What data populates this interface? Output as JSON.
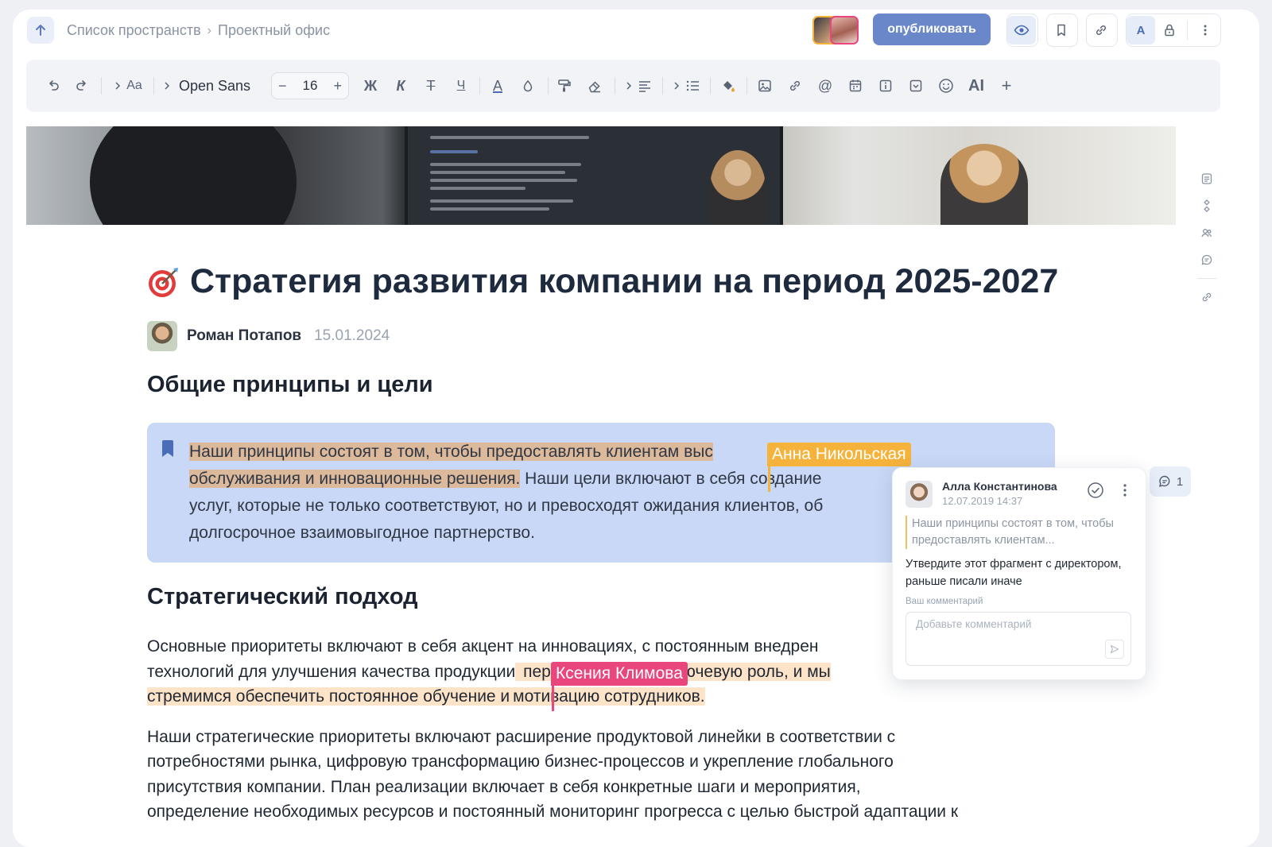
{
  "breadcrumb": {
    "items": [
      "Список пространств",
      "Проектный офис"
    ],
    "separator": "›"
  },
  "header": {
    "publish_label": "опубликовать",
    "font_badge": "A"
  },
  "toolbar": {
    "font_size_label": "Aa",
    "font_family": "Open Sans",
    "font_size": "16",
    "minus": "−",
    "plus": "+",
    "bold": "Ж",
    "italic": "К",
    "strike": "Т",
    "underline": "Ч",
    "text_color": "A",
    "mention": "@",
    "ai": "AI",
    "add": "+",
    "icons": [
      "undo-icon",
      "redo-icon",
      "chevron-right-icon",
      "text-size-icon",
      "font-family",
      "minus-icon",
      "plus-icon",
      "bold-icon",
      "italic-icon",
      "strikethrough-icon",
      "underline-icon",
      "text-color-icon",
      "highlight-drop-icon",
      "format-painter-icon",
      "eraser-icon",
      "align-left-icon",
      "bullet-list-icon",
      "fill-bucket-icon",
      "image-icon",
      "link-icon",
      "mention-icon",
      "calendar-icon",
      "info-icon",
      "dropdown-icon",
      "emoji-icon",
      "ai-icon",
      "plus-icon"
    ]
  },
  "document": {
    "title": "Стратегия развития компании на период 2025-2027",
    "author": "Роман Потапов",
    "date": "15.01.2024",
    "section1_heading": "Общие принципы и цели",
    "section2_heading": "Стратегический подход",
    "callout": {
      "line1_hl": "Наши принципы состоят в том, чтобы предоставлять клиентам выс",
      "line2_hl": "обслуживания и инновационные решения.",
      "line2_rest_a": " Наши цели включают в",
      "line2_rest_b": " себя создание",
      "line3": "услуг, которые не только соответствуют, но и превосходят ожидания клиентов, об",
      "line4": "долгосрочное взаимовыгодное партнерство."
    },
    "para1": {
      "line1": "Основные приоритеты включают в себя акцент на инновациях, с постоянным внедрен",
      "line2_a": "технологий для улучшения качества продукции",
      "line2_b": " персонала играет ключевую роль, и мы",
      "line3_hl_a": "стремимся обеспечить постоянное обучение и",
      "line3_hl_b": "мотивацию сотрудников."
    },
    "para2": {
      "line1": "Наши стратегические приоритеты включают расширение продуктовой линейки в соответствии с",
      "line2": "потребностями рынка, цифровую трансформацию бизнес-процессов и укрепление глобального",
      "line3": "присутствия компании. План реализации включает в себя конкретные шаги и мероприятия,",
      "line4": "определение необходимых ресурсов и постоянный мониторинг прогресса с целью быстрой адаптации к"
    }
  },
  "collaborators": {
    "cursor1": {
      "name": "Анна Никольская",
      "color": "#f5b33b"
    },
    "cursor2": {
      "name": "Ксения Климова",
      "color": "#e8467c"
    }
  },
  "comment": {
    "count": "1",
    "author": "Алла Константинова",
    "datetime": "12.07.2019 14:37",
    "quote": "Наши принципы состоят в том, чтобы предоставлять клиентам...",
    "message": "Утвердите этот фрагмент с директором, раньше писали иначе",
    "input_label": "Ваш комментарий",
    "input_placeholder": "Добавьте комментарий"
  },
  "colors": {
    "accent": "#6a88c9",
    "callout_bg": "#c9d8f6",
    "highlight": "#dbb99a",
    "highlight_light": "#fde3c8"
  }
}
